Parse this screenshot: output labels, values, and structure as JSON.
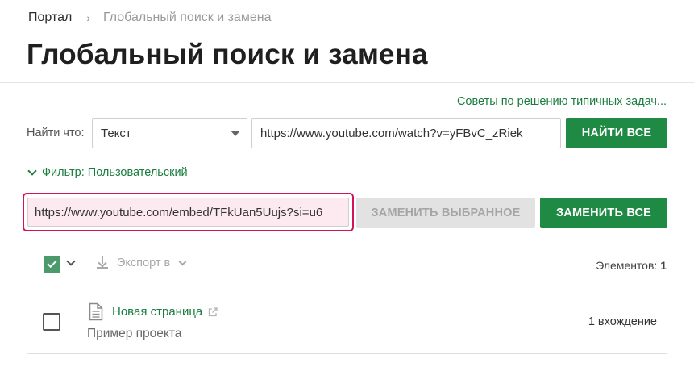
{
  "breadcrumb": {
    "home": "Портал",
    "separator": "›",
    "current": "Глобальный поиск и замена"
  },
  "page_title": "Глобальный поиск и замена",
  "tips_link": "Советы по решению типичных задач...",
  "search": {
    "label": "Найти что:",
    "type_selected": "Текст",
    "query_value": "https://www.youtube.com/watch?v=yFBvC_zRiek",
    "find_all_label": "НАЙТИ ВСЕ"
  },
  "filter": {
    "label": "Фильтр: Пользовательский"
  },
  "replace": {
    "value": "https://www.youtube.com/embed/TFkUan5Uujs?si=u6",
    "replace_selected_label": "ЗАМЕНИТЬ ВЫБРАННОЕ",
    "replace_all_label": "ЗАМЕНИТЬ ВСЕ"
  },
  "toolbar": {
    "export_label": "Экспорт в",
    "count_label": "Элементов:",
    "count_value": "1"
  },
  "results": [
    {
      "page_name": "Новая страница",
      "project": "Пример проекта",
      "occurrences": "1 вхождение",
      "checked": false
    }
  ],
  "colors": {
    "accent_green": "#1f8a43",
    "link_green": "#1a7d3f",
    "highlight_border": "#d4145a",
    "highlight_fill": "#fdeaf0",
    "disabled_bg": "#e2e2e2"
  },
  "icons": [
    "chevron-right-icon",
    "dropdown-caret-icon",
    "chevron-down-icon",
    "checkmark-icon",
    "download-icon",
    "document-icon",
    "external-link-icon"
  ]
}
